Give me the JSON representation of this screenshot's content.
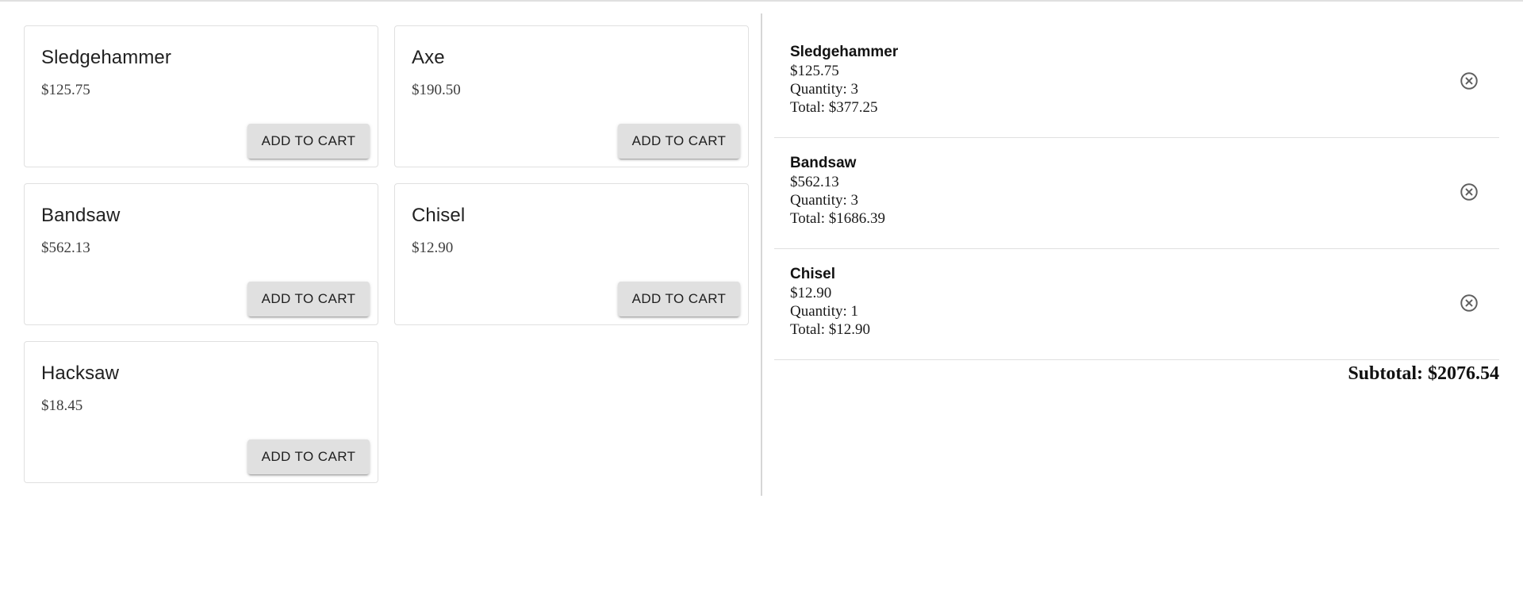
{
  "catalog": {
    "button_label": "ADD TO CART",
    "products": [
      {
        "name": "Sledgehammer",
        "price": "$125.75"
      },
      {
        "name": "Axe",
        "price": "$190.50"
      },
      {
        "name": "Bandsaw",
        "price": "$562.13"
      },
      {
        "name": "Chisel",
        "price": "$12.90"
      },
      {
        "name": "Hacksaw",
        "price": "$18.45"
      }
    ]
  },
  "cart": {
    "items": [
      {
        "name": "Sledgehammer",
        "price": "$125.75",
        "quantity": "Quantity: 3",
        "total": "Total: $377.25"
      },
      {
        "name": "Bandsaw",
        "price": "$562.13",
        "quantity": "Quantity: 3",
        "total": "Total: $1686.39"
      },
      {
        "name": "Chisel",
        "price": "$12.90",
        "quantity": "Quantity: 1",
        "total": "Total: $12.90"
      }
    ],
    "subtotal": "Subtotal: $2076.54",
    "remove_icon": "close-circle-icon"
  },
  "colors": {
    "button_bg": "#e0e0e0",
    "border": "#e0e0e0",
    "icon": "#5f5f5f"
  }
}
